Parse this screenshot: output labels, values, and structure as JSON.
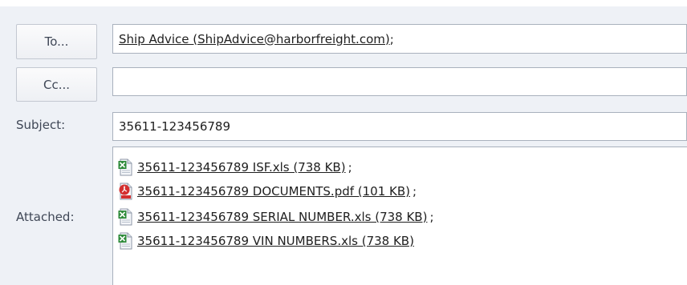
{
  "header": {
    "to_button": "To...",
    "cc_button": "Cc...",
    "to_value": "Ship Advice (ShipAdvice@harborfreight.com)",
    "to_separator": ";",
    "cc_value": "",
    "subject_label": "Subject:",
    "subject_value": "35611-123456789",
    "attached_label": "Attached:"
  },
  "attachments": [
    {
      "name": "35611-123456789 ISF.xls (738 KB)",
      "sep": ";",
      "icon": "excel-file-icon"
    },
    {
      "name": "35611-123456789 DOCUMENTS.pdf (101 KB)",
      "sep": ";",
      "icon": "pdf-file-icon"
    },
    {
      "name": "35611-123456789 SERIAL NUMBER.xls (738 KB)",
      "sep": ";",
      "icon": "excel-file-icon"
    },
    {
      "name": "35611-123456789 VIN NUMBERS.xls (738 KB)",
      "sep": "",
      "icon": "excel-file-icon"
    }
  ],
  "colors": {
    "background": "#eef1f6",
    "excel_green": "#2e8b3a",
    "pdf_red": "#d32f2f"
  }
}
